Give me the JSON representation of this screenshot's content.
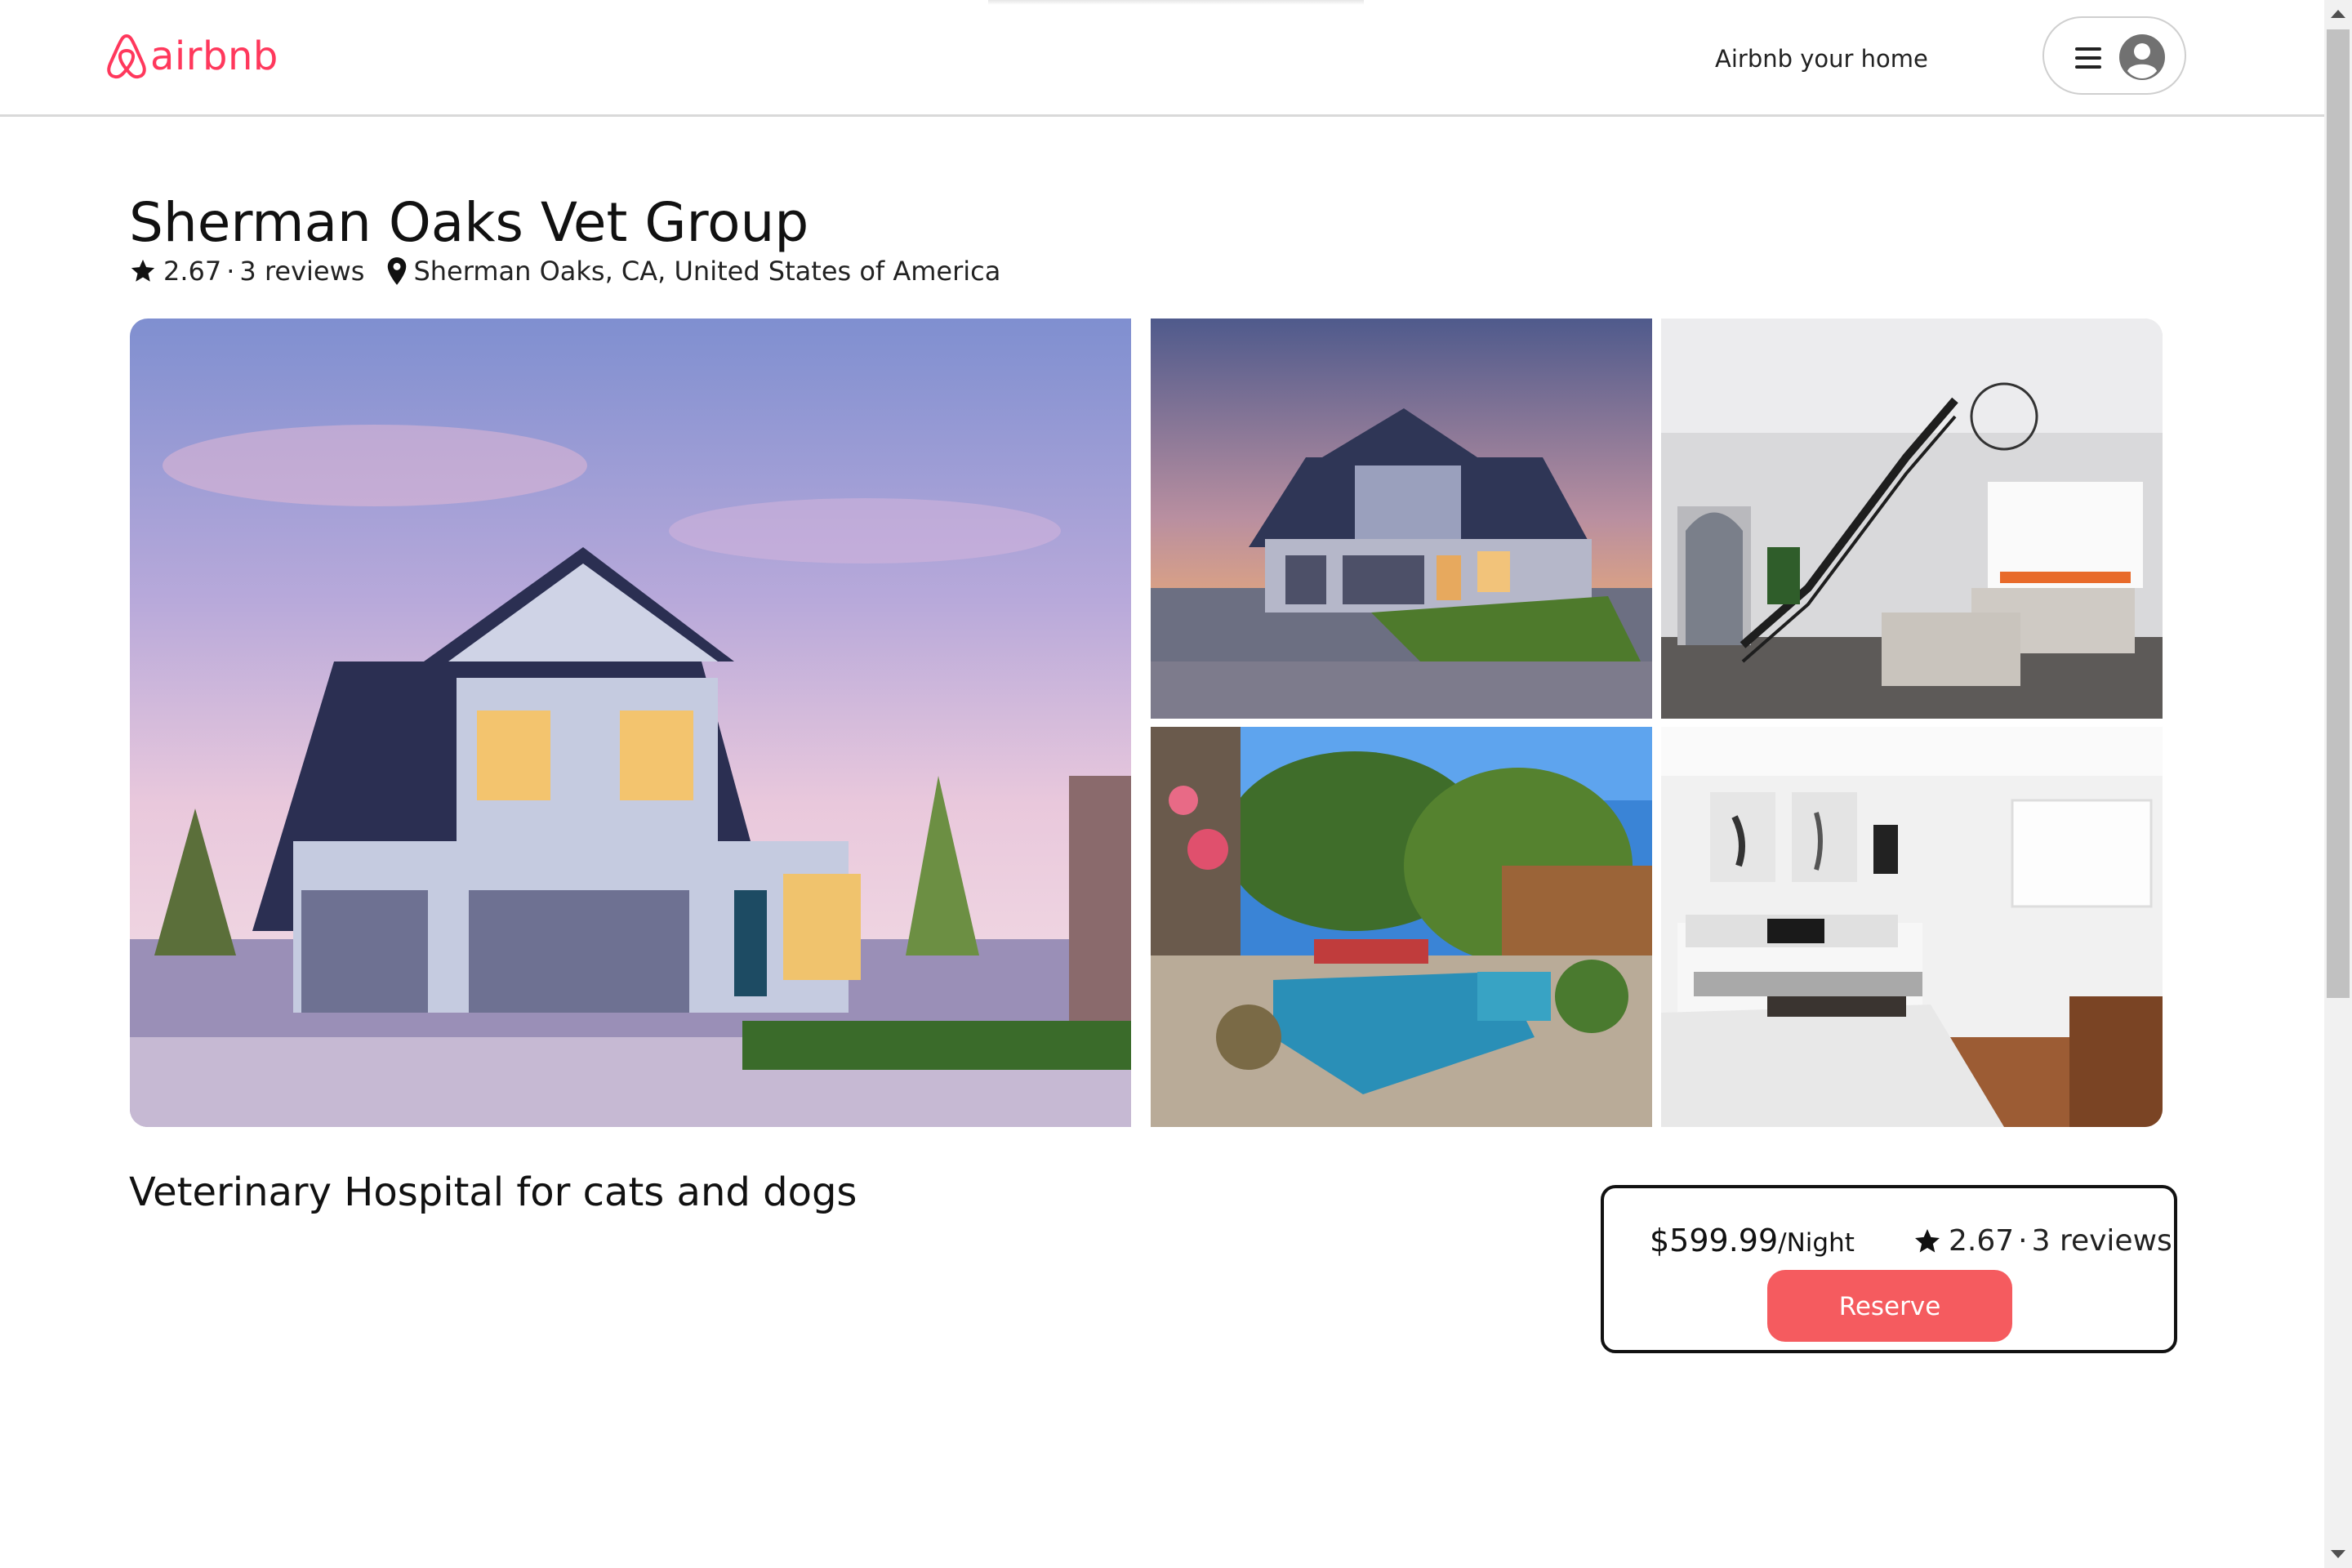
{
  "header": {
    "logo_text": "airbnb",
    "host_link": "Airbnb your home",
    "brand_color": "#ff385c"
  },
  "listing": {
    "title": "Sherman Oaks Vet Group",
    "rating": "2.67",
    "separator": "·",
    "reviews": "3 reviews",
    "location": "Sherman Oaks, CA, United States of America",
    "description": "Veterinary Hospital for cats and dogs"
  },
  "gallery": {
    "images": [
      {
        "name": "house-exterior-main"
      },
      {
        "name": "house-exterior-dusk"
      },
      {
        "name": "living-room-staircase"
      },
      {
        "name": "backyard-pool"
      },
      {
        "name": "bedroom"
      }
    ]
  },
  "booking": {
    "price": "$599.99",
    "price_unit": "/Night",
    "rating": "2.67",
    "separator": "·",
    "reviews": "3 reviews",
    "reserve_label": "Reserve",
    "button_color": "#f55b5f"
  },
  "icons": {
    "logo": "airbnb-logo-icon",
    "menu": "hamburger-menu-icon",
    "avatar": "user-avatar-icon",
    "star": "star-icon",
    "pin": "location-pin-icon"
  }
}
